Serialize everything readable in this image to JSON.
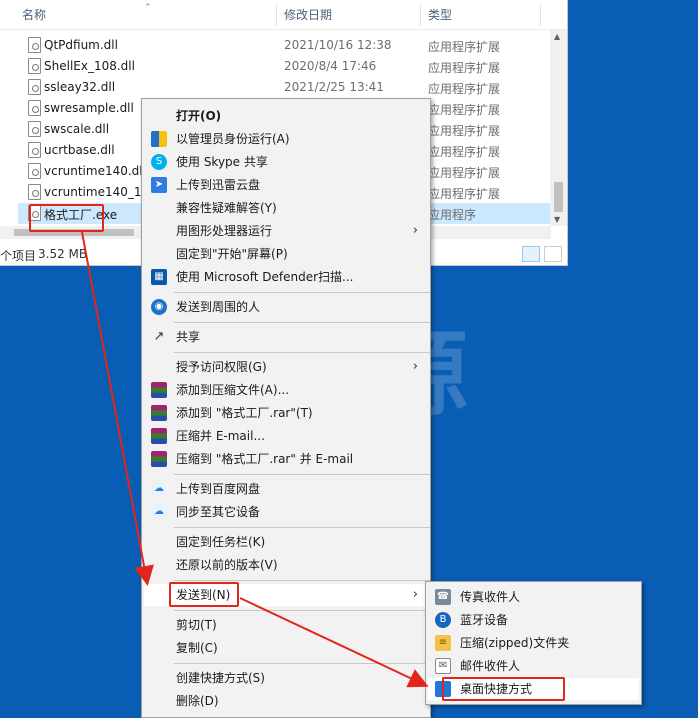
{
  "explorer": {
    "columns": {
      "name": "名称",
      "date": "修改日期",
      "type": "类型"
    },
    "files": [
      {
        "name": "QtPdfium.dll",
        "date": "2021/10/16 12:38",
        "type": "应用程序扩展"
      },
      {
        "name": "ShellEx_108.dll",
        "date": "2020/8/4 17:46",
        "type": "应用程序扩展"
      },
      {
        "name": "ssleay32.dll",
        "date": "2021/2/25 13:41",
        "type": "应用程序扩展"
      },
      {
        "name": "swresample.dll",
        "date": "",
        "type": "应用程序扩展"
      },
      {
        "name": "swscale.dll",
        "date": "",
        "type": "应用程序扩展"
      },
      {
        "name": "ucrtbase.dll",
        "date": "",
        "type": "应用程序扩展"
      },
      {
        "name": "vcruntime140.dll",
        "date": "",
        "type": "应用程序扩展"
      },
      {
        "name": "vcruntime140_1.d",
        "date": "",
        "type": "应用程序扩展"
      },
      {
        "name": "格式工厂.exe",
        "date": "",
        "type": "应用程序"
      }
    ],
    "status": {
      "items": "个项目",
      "size": "3.52 MB"
    }
  },
  "context_menu": {
    "items": [
      {
        "label": "打开(O)",
        "icon": "",
        "bold": true
      },
      {
        "label": "以管理员身份运行(A)",
        "icon": "shield-icon"
      },
      {
        "label": "使用 Skype 共享",
        "icon": "skype-icon"
      },
      {
        "label": "上传到迅雷云盘",
        "icon": "thunder-icon"
      },
      {
        "label": "兼容性疑难解答(Y)",
        "icon": ""
      },
      {
        "label": "用图形处理器运行",
        "icon": "",
        "submenu": true
      },
      {
        "label": "固定到\"开始\"屏幕(P)",
        "icon": ""
      },
      {
        "label": "使用 Microsoft Defender扫描...",
        "icon": "defender-icon"
      },
      {
        "label": "发送到周围的人",
        "icon": "nearby-share-icon"
      },
      {
        "label": "共享",
        "icon": "share-icon"
      },
      {
        "label": "授予访问权限(G)",
        "icon": "",
        "submenu": true
      },
      {
        "label": "添加到压缩文件(A)...",
        "icon": "winrar-icon"
      },
      {
        "label": "添加到 \"格式工厂.rar\"(T)",
        "icon": "winrar-icon"
      },
      {
        "label": "压缩并 E-mail...",
        "icon": "winrar-icon"
      },
      {
        "label": "压缩到 \"格式工厂.rar\" 并 E-mail",
        "icon": "winrar-icon"
      },
      {
        "label": "上传到百度网盘",
        "icon": "baidu-cloud-icon"
      },
      {
        "label": "同步至其它设备",
        "icon": "baidu-cloud-icon"
      },
      {
        "label": "固定到任务栏(K)",
        "icon": ""
      },
      {
        "label": "还原以前的版本(V)",
        "icon": ""
      },
      {
        "label": "发送到(N)",
        "icon": "",
        "submenu": true
      },
      {
        "label": "剪切(T)",
        "icon": ""
      },
      {
        "label": "复制(C)",
        "icon": ""
      },
      {
        "label": "创建快捷方式(S)",
        "icon": ""
      },
      {
        "label": "删除(D)",
        "icon": ""
      }
    ]
  },
  "send_to_menu": {
    "items": [
      {
        "label": "传真收件人",
        "icon": "fax-icon"
      },
      {
        "label": "蓝牙设备",
        "icon": "bluetooth-icon"
      },
      {
        "label": "压缩(zipped)文件夹",
        "icon": "zip-folder-icon"
      },
      {
        "label": "邮件收件人",
        "icon": "mail-icon"
      },
      {
        "label": "桌面快捷方式",
        "icon": "desktop-icon"
      }
    ]
  },
  "watermark": "@源",
  "colors": {
    "desktop": "#0a5db5",
    "highlight_box": "#e3261c",
    "selection": "#cce8ff"
  }
}
